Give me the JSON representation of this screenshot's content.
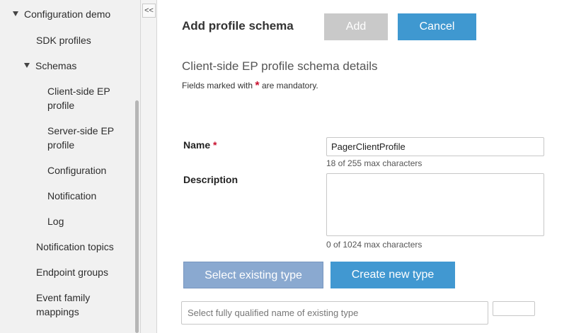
{
  "sidebar": {
    "items": [
      {
        "label": "Configuration demo"
      },
      {
        "label": "SDK profiles"
      },
      {
        "label": "Schemas"
      },
      {
        "label": "Client-side EP"
      },
      {
        "label": "profile"
      },
      {
        "label": "Server-side EP"
      },
      {
        "label": "profile"
      },
      {
        "label": "Configuration"
      },
      {
        "label": "Notification"
      },
      {
        "label": "Log"
      },
      {
        "label": "Notification topics"
      },
      {
        "label": "Endpoint groups"
      },
      {
        "label": "Event family"
      },
      {
        "label": "mappings"
      }
    ],
    "collapse_label": "<<"
  },
  "header": {
    "title": "Add profile schema",
    "add_label": "Add",
    "cancel_label": "Cancel"
  },
  "form": {
    "section_title": "Client-side EP profile schema details",
    "mandatory_prefix": "Fields marked with",
    "mandatory_star": "*",
    "mandatory_suffix": "are mandatory.",
    "name_label": "Name",
    "name_star": "*",
    "name_value": "PagerClientProfile",
    "name_hint": "18 of 255 max characters",
    "description_label": "Description",
    "description_value": "",
    "description_hint": "0 of 1024 max characters",
    "select_existing_label": "Select existing type",
    "create_new_label": "Create new type",
    "type_placeholder": "Select fully qualified name of existing type"
  },
  "colors": {
    "accent": "#3f98d0",
    "disabled": "#c9c9c9",
    "mandatory": "#c8102e"
  }
}
